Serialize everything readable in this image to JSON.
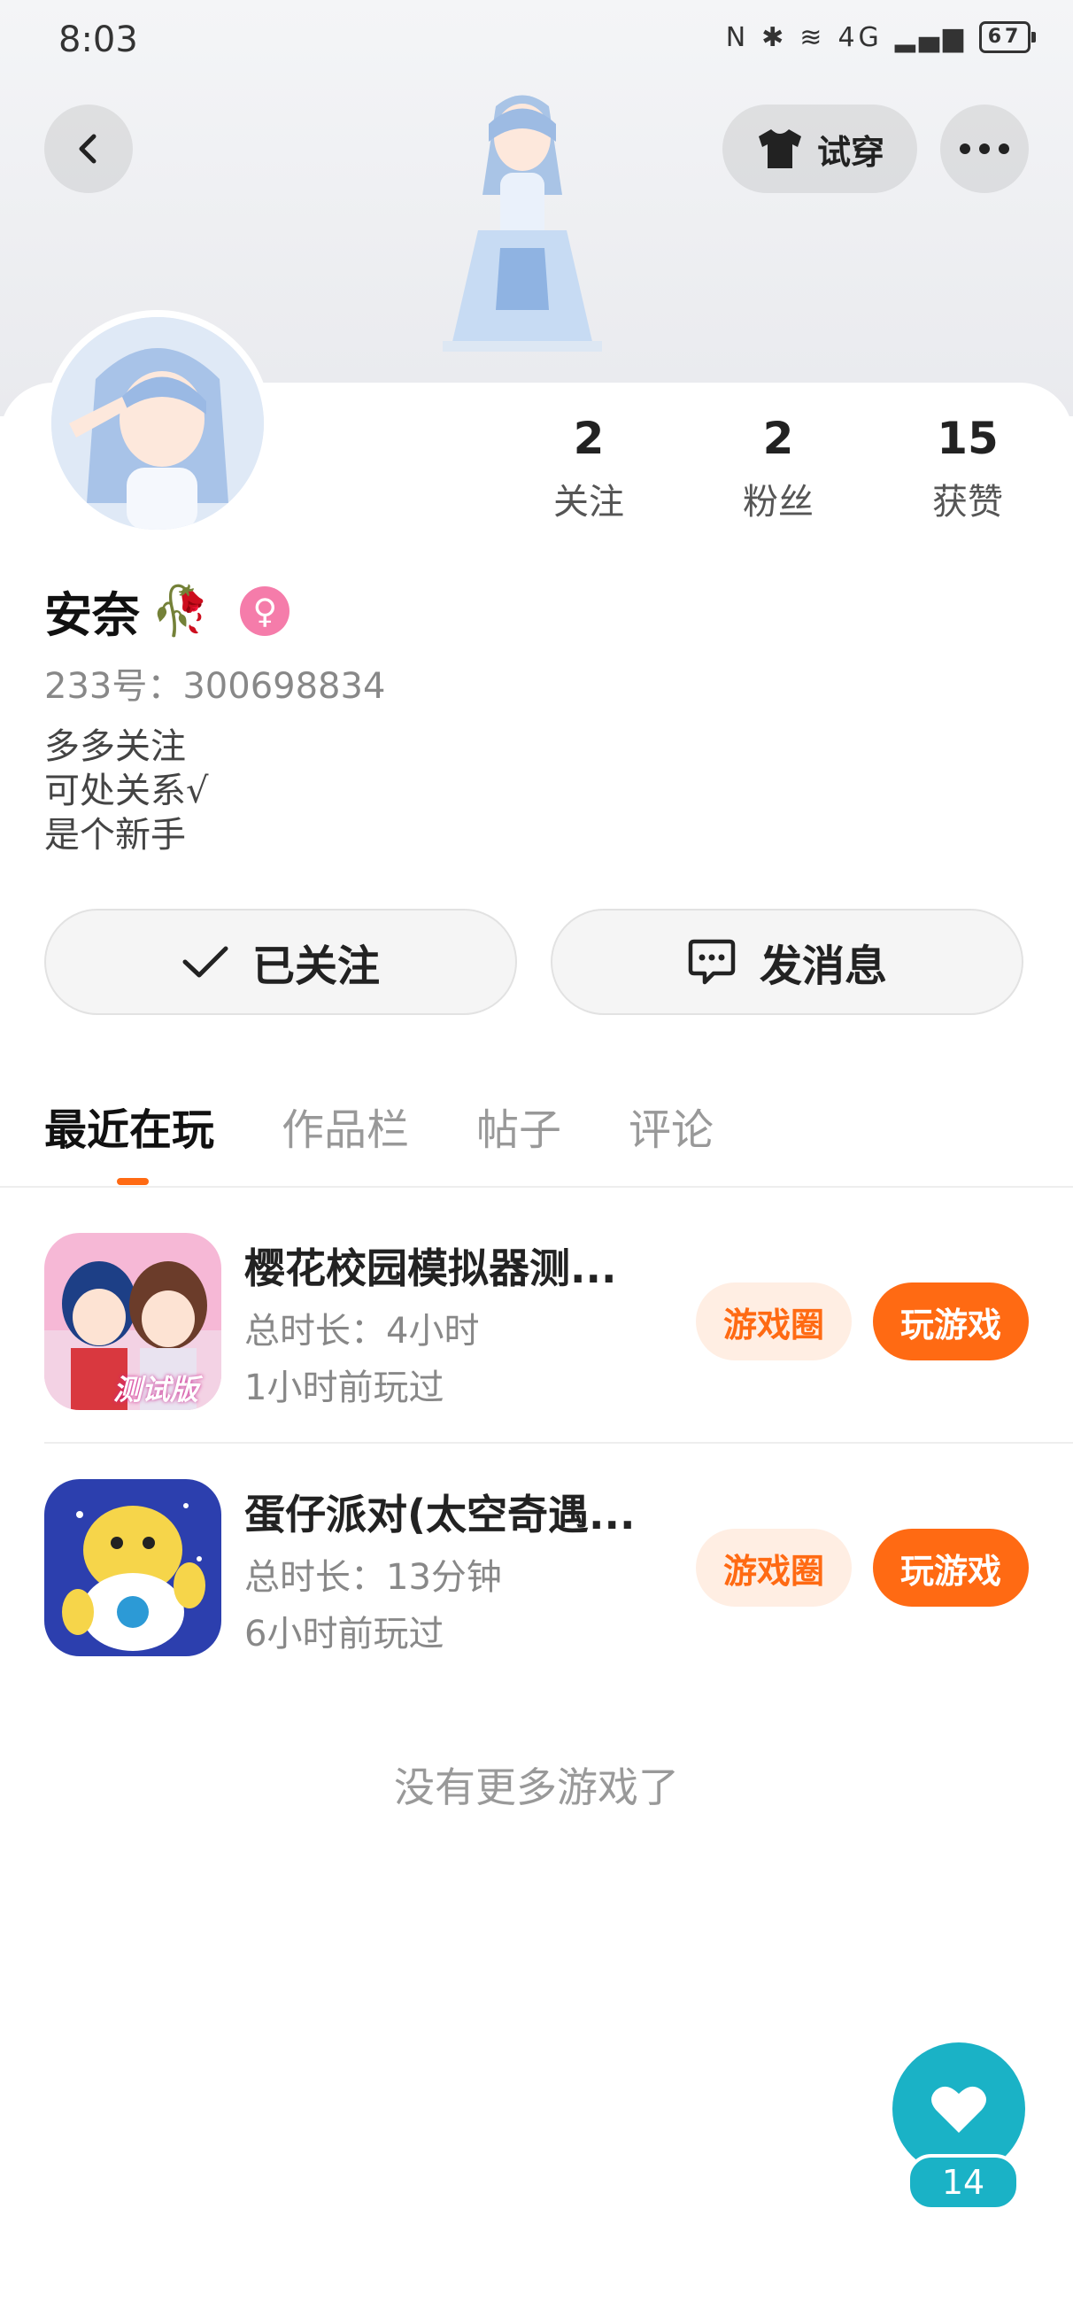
{
  "status_bar": {
    "time": "8:03",
    "battery": "67",
    "network": "4G"
  },
  "header": {
    "try_on_label": "试穿"
  },
  "stats": [
    {
      "value": "2",
      "label": "关注"
    },
    {
      "value": "2",
      "label": "粉丝"
    },
    {
      "value": "15",
      "label": "获赞"
    }
  ],
  "profile": {
    "name": "安奈",
    "name_emoji": "🥀",
    "gender_symbol": "♀",
    "uid": "233号：300698834",
    "bio_lines": [
      "多多关注",
      "可处关系√",
      "是个新手"
    ]
  },
  "actions": {
    "follow_label": "已关注",
    "message_label": "发消息"
  },
  "tabs": [
    {
      "label": "最近在玩",
      "active": true
    },
    {
      "label": "作品栏",
      "active": false
    },
    {
      "label": "帖子",
      "active": false
    },
    {
      "label": "评论",
      "active": false
    }
  ],
  "games": [
    {
      "name": "樱花校园模拟器测...",
      "duration": "总时长：4小时",
      "last_played": "1小时前玩过",
      "icon_badge": "测试版",
      "circle_label": "游戏圈",
      "play_label": "玩游戏"
    },
    {
      "name": "蛋仔派对(太空奇遇...",
      "duration": "总时长：13分钟",
      "last_played": "6小时前玩过",
      "circle_label": "游戏圈",
      "play_label": "玩游戏"
    }
  ],
  "list_end_text": "没有更多游戏了",
  "like": {
    "count": "14"
  },
  "colors": {
    "accent": "#ff6a13",
    "accent_light": "#ffeee3",
    "like_teal": "#1ab2c6",
    "gender_pink": "#f57caa"
  }
}
